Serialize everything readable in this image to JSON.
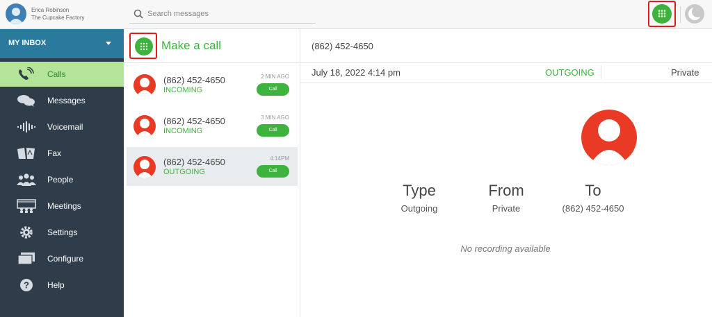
{
  "user": {
    "name": "Erica Robinson",
    "company": "The Cupcake Factory"
  },
  "search": {
    "placeholder": "Search messages"
  },
  "colors": {
    "accent_green": "#3db33d",
    "sidebar_bg": "#2f3d4a",
    "inbox_header": "#2a7a9e",
    "active_nav": "#b4e39a",
    "avatar_red": "#e83a24",
    "highlight_red": "#e01b1b"
  },
  "sidebar": {
    "inbox_label": "MY INBOX",
    "items": [
      {
        "label": "Calls",
        "icon": "phone-icon",
        "active": true
      },
      {
        "label": "Messages",
        "icon": "chat-bubbles-icon"
      },
      {
        "label": "Voicemail",
        "icon": "voicemail-wave-icon"
      },
      {
        "label": "Fax",
        "icon": "fax-icon"
      },
      {
        "label": "People",
        "icon": "people-icon"
      },
      {
        "label": "Meetings",
        "icon": "meetings-icon"
      },
      {
        "label": "Settings",
        "icon": "gear-icon"
      },
      {
        "label": "Configure",
        "icon": "configure-icon"
      },
      {
        "label": "Help",
        "icon": "help-icon"
      }
    ]
  },
  "list": {
    "make_call_label": "Make a call",
    "calls": [
      {
        "number": "(862) 452-4650",
        "direction": "INCOMING",
        "time": "2 MIN AGO",
        "button": "Call"
      },
      {
        "number": "(862) 452-4650",
        "direction": "INCOMING",
        "time": "3 MIN AGO",
        "button": "Call"
      },
      {
        "number": "(862) 452-4650",
        "direction": "OUTGOING",
        "time": "4:14PM",
        "button": "Call",
        "selected": true
      }
    ]
  },
  "detail": {
    "number": "(862) 452-4650",
    "date": "July 18, 2022 4:14 pm",
    "status": "OUTGOING",
    "caller_id": "Private",
    "type_label": "Type",
    "type_value": "Outgoing",
    "from_label": "From",
    "from_value": "Private",
    "to_label": "To",
    "to_value": "(862) 452-4650",
    "no_recording": "No recording available"
  }
}
